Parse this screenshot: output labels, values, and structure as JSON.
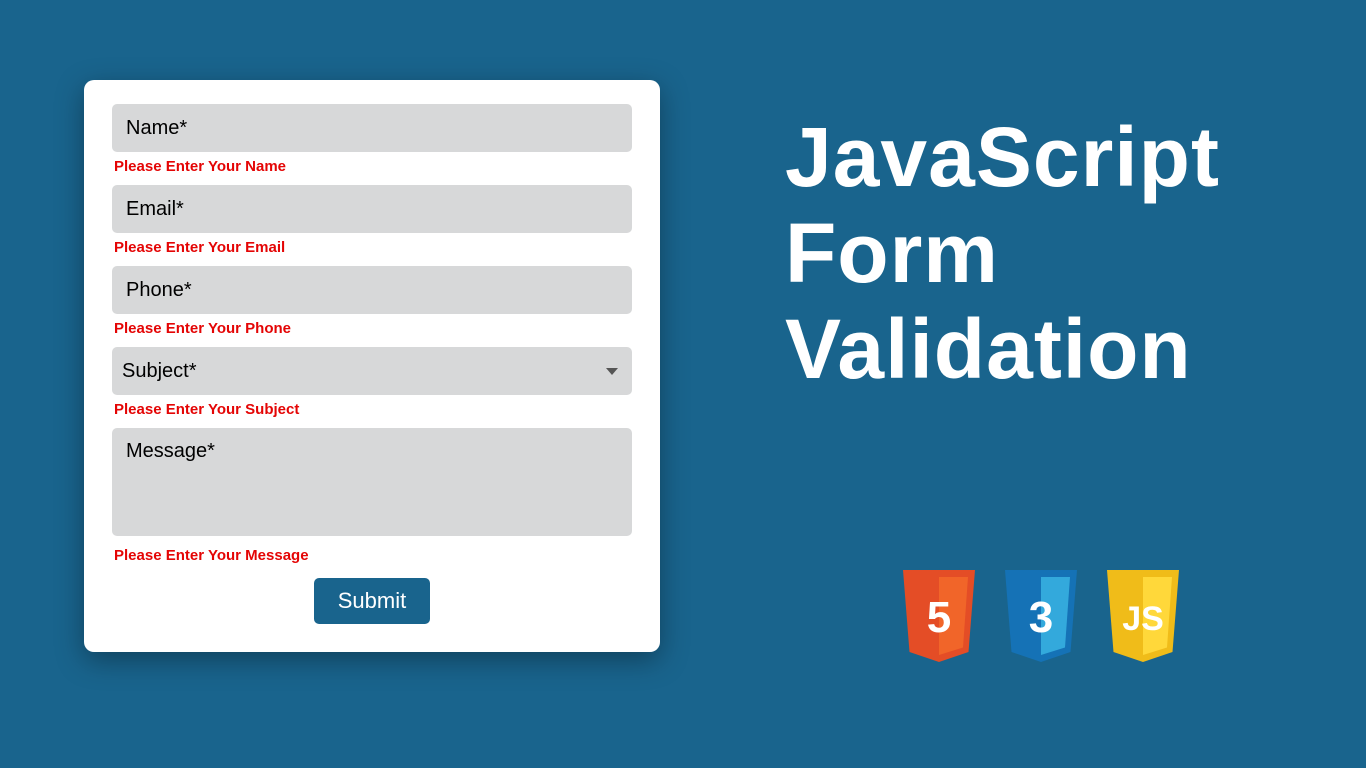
{
  "form": {
    "name": {
      "placeholder": "Name*",
      "error": "Please Enter Your Name"
    },
    "email": {
      "placeholder": "Email*",
      "error": "Please Enter Your Email"
    },
    "phone": {
      "placeholder": "Phone*",
      "error": "Please Enter Your Phone"
    },
    "subject": {
      "placeholder": "Subject*",
      "error": "Please Enter Your Subject"
    },
    "message": {
      "placeholder": "Message*",
      "error": "Please Enter Your Message"
    },
    "submit": "Submit"
  },
  "headline": {
    "line1": "JavaScript",
    "line2": "Form",
    "line3": "Validation"
  },
  "icons": {
    "html5": "5",
    "css3": "3",
    "js": "JS"
  }
}
